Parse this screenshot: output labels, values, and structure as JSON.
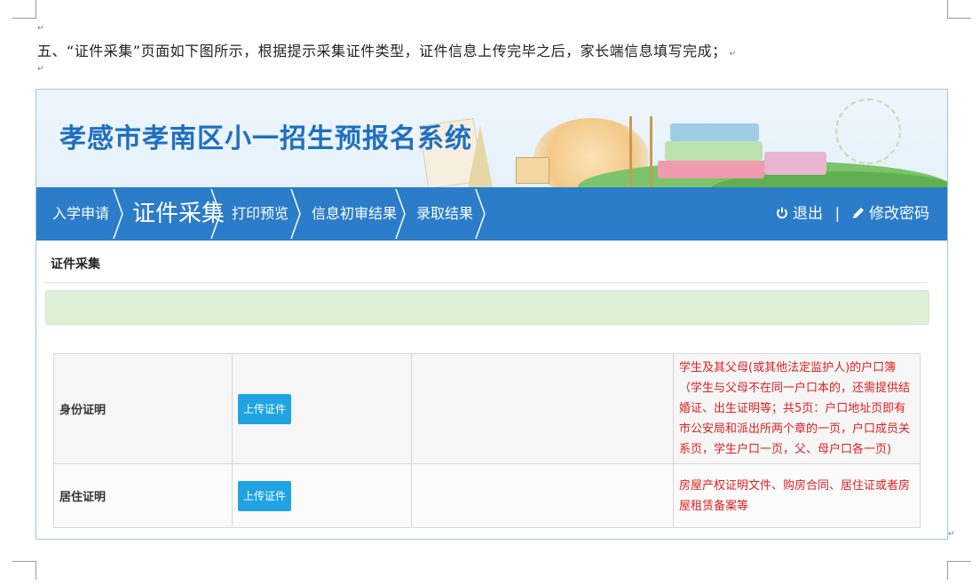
{
  "document": {
    "paragraph": "五、“证件采集”页面如下图所示，根据提示采集证件类型，证件信息上传完毕之后，家长端信息填写完成；",
    "return_mark": "↵"
  },
  "app": {
    "title": "孝感市孝南区小一招生预报名系统",
    "nav": {
      "items": [
        {
          "label": "入学申请"
        },
        {
          "label": "证件采集"
        },
        {
          "label": "打印预览"
        },
        {
          "label": "信息初审结果"
        },
        {
          "label": "录取结果"
        }
      ],
      "active_index": 1,
      "logout_label": "退出",
      "separator": "|",
      "change_password_label": "修改密码"
    },
    "section_title": "证件采集",
    "notice_text": "",
    "documents": [
      {
        "name": "身份证明",
        "button_label": "上传证件",
        "file": "",
        "requirement": "学生及其父母(或其他法定监护人)的户口簿（学生与父母不在同一户口本的，还需提供结婚证、出生证明等；共5页：户口地址页即有市公安局和派出所两个章的一页，户口成员关系页，学生户口一页，父、母户口各一页)"
      },
      {
        "name": "居住证明",
        "button_label": "上传证件",
        "file": "",
        "requirement": "房屋产权证明文件、购房合同、居住证或者房屋租赁备案等"
      }
    ]
  },
  "colors": {
    "nav_bg": "#2b7cc9",
    "title_blue": "#1f6fbf",
    "button_bg": "#1fa3e3",
    "requirement_red": "#e02020",
    "notice_bg": "#def0d8"
  }
}
